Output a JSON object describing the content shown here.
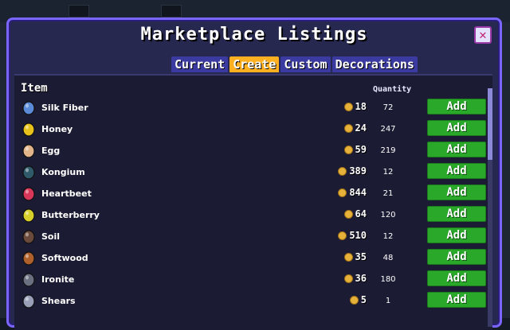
{
  "window": {
    "title": "Marketplace Listings",
    "close_label": "✕"
  },
  "tabs": [
    {
      "label": "Current",
      "active": false
    },
    {
      "label": "Create",
      "active": true
    },
    {
      "label": "Custom",
      "active": false
    },
    {
      "label": "Decorations",
      "active": false
    }
  ],
  "list": {
    "item_header": "Item",
    "quantity_header": "Quantity",
    "add_label": "Add",
    "rows": [
      {
        "name": "Silk Fiber",
        "price": "18",
        "qty": "72",
        "icon": "silk-fiber-icon",
        "color": "#5a8ad8"
      },
      {
        "name": "Honey",
        "price": "24",
        "qty": "247",
        "icon": "honey-icon",
        "color": "#e8c21a"
      },
      {
        "name": "Egg",
        "price": "59",
        "qty": "219",
        "icon": "egg-icon",
        "color": "#e2b48a"
      },
      {
        "name": "Kongium",
        "price": "389",
        "qty": "12",
        "icon": "kongium-icon",
        "color": "#2f5a6a"
      },
      {
        "name": "Heartbeet",
        "price": "844",
        "qty": "21",
        "icon": "heartbeet-icon",
        "color": "#d8375a"
      },
      {
        "name": "Butterberry",
        "price": "64",
        "qty": "120",
        "icon": "butterberry-icon",
        "color": "#d8d02a"
      },
      {
        "name": "Soil",
        "price": "510",
        "qty": "12",
        "icon": "soil-icon",
        "color": "#6a4a3a"
      },
      {
        "name": "Softwood",
        "price": "35",
        "qty": "48",
        "icon": "softwood-icon",
        "color": "#b0602a"
      },
      {
        "name": "Ironite",
        "price": "36",
        "qty": "180",
        "icon": "ironite-icon",
        "color": "#6a7080"
      },
      {
        "name": "Shears",
        "price": "5",
        "qty": "1",
        "icon": "shears-icon",
        "color": "#9aa0b8"
      }
    ]
  }
}
